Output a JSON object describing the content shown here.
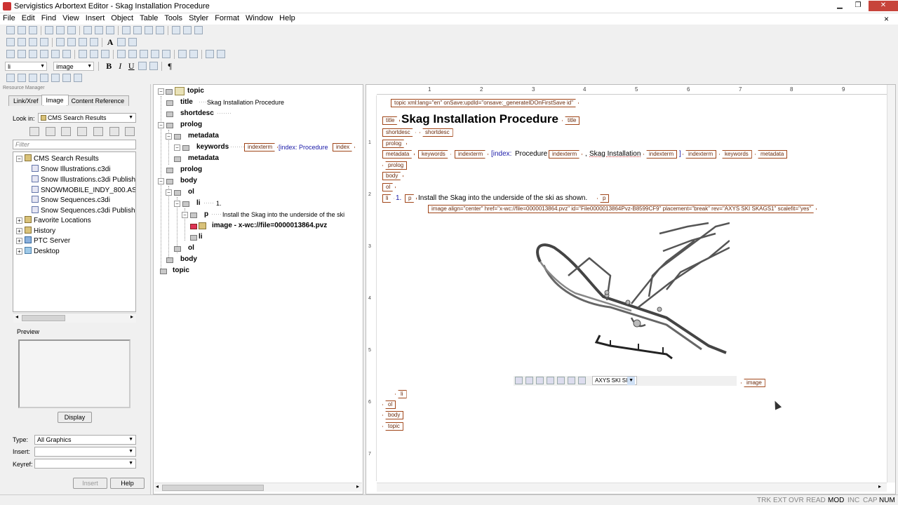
{
  "window": {
    "title": "Servigistics Arbortext Editor - Skag Installation Procedure",
    "min": "▁",
    "max": "❐",
    "close": "✕"
  },
  "menu": [
    "File",
    "Edit",
    "Find",
    "View",
    "Insert",
    "Object",
    "Table",
    "Tools",
    "Styler",
    "Format",
    "Window",
    "Help"
  ],
  "menu_close": "×",
  "toolbar": {
    "element_combo": "li",
    "style_combo": "image",
    "bold": "B",
    "italic": "I",
    "underline": "U",
    "pilcrow": "¶"
  },
  "resource_manager": {
    "panel_title": "Resource Manager",
    "tabs": [
      "Link/Xref",
      "Image",
      "Content Reference"
    ],
    "look_in_label": "Look in:",
    "look_in_value": "CMS Search Results",
    "filter_placeholder": "Filter",
    "tree": [
      {
        "label": "CMS Search Results",
        "level": 0,
        "expander": "−",
        "kind": "folder"
      },
      {
        "label": "Snow Illustrations.c3di",
        "level": 1,
        "expander": "",
        "kind": "doc"
      },
      {
        "label": "Snow Illustrations.c3di Publishe",
        "level": 1,
        "expander": "",
        "kind": "doc"
      },
      {
        "label": "SNOWMOBILE_INDY_800.ASM",
        "level": 1,
        "expander": "",
        "kind": "doc"
      },
      {
        "label": "Snow Sequences.c3di",
        "level": 1,
        "expander": "",
        "kind": "doc"
      },
      {
        "label": "Snow Sequences.c3di Publishe",
        "level": 1,
        "expander": "",
        "kind": "doc"
      },
      {
        "label": "Favorite Locations",
        "level": 0,
        "expander": "+",
        "kind": "folder"
      },
      {
        "label": "History",
        "level": 0,
        "expander": "+",
        "kind": "folder"
      },
      {
        "label": "PTC Server",
        "level": 0,
        "expander": "+",
        "kind": "folder"
      },
      {
        "label": "Desktop",
        "level": 0,
        "expander": "+",
        "kind": "folder"
      }
    ],
    "preview_label": "Preview",
    "display_button": "Display",
    "type_label": "Type:",
    "type_value": "All Graphics",
    "insert_label": "Insert:",
    "insert_value": "",
    "keyref_label": "Keyref:",
    "keyref_value": "",
    "insert_button": "Insert",
    "help_button": "Help"
  },
  "structure": {
    "rows": [
      {
        "label": "topic",
        "text": ""
      },
      {
        "label": "title",
        "text": "Skag Installation Procedure"
      },
      {
        "label": "shortdesc",
        "text": ""
      },
      {
        "label": "prolog",
        "text": ""
      },
      {
        "label": "metadata",
        "text": ""
      },
      {
        "label": "keywords",
        "text": ""
      },
      {
        "label": "metadata",
        "text": ""
      },
      {
        "label": "prolog",
        "text": ""
      },
      {
        "label": "body",
        "text": ""
      },
      {
        "label": "ol",
        "text": ""
      },
      {
        "label": "li",
        "text": "1."
      },
      {
        "label": "p",
        "text": "Install the Skag into the underside of the ski"
      },
      {
        "label": "image - x-wc://file=0000013864.pvz",
        "text": ""
      },
      {
        "label": "li",
        "text": ""
      },
      {
        "label": "ol",
        "text": ""
      },
      {
        "label": "body",
        "text": ""
      },
      {
        "label": "topic",
        "text": ""
      }
    ],
    "keywords_tag": "indexterm",
    "keywords_index": "[index: Procedure",
    "keywords_tag2": "index"
  },
  "ruler_numbers": [
    "1",
    "2",
    "3",
    "4",
    "5",
    "6",
    "7",
    "8",
    "9"
  ],
  "vruler_numbers": [
    "1",
    "2",
    "3",
    "4",
    "5",
    "6",
    "7"
  ],
  "document": {
    "topic_attrs": "topic xml:lang=\"en\" onSave:updId=\"onsave:_generateIDOnFirstSave id\"",
    "title_tag": "title",
    "title_text": "Skag Installation Procedure",
    "shortdesc_tag": "shortdesc",
    "prolog_tag": "prolog",
    "metadata_tag": "metadata",
    "keywords_tag": "keywords",
    "indexterm_tag": "indexterm",
    "index_label": "[index:",
    "index_term1": "Procedure",
    "comma": ",",
    "index_term2": "Skag Installation",
    "bracket": "]",
    "body_tag": "body",
    "ol_tag": "ol",
    "li_tag": "li",
    "p_tag": "p",
    "item_number": "1.",
    "step_text": "Install the Skag into the underside of the ski as shown.",
    "image_attrs": "image align=\"center\" href=\"x-wc://file=0000013864.pvz\" id=\"File0000013864Pvz-B8599CF9\" placement=\"break\" rev=\"AXYS SKI SKAGS1\" scalefit=\"yes\"",
    "image_tag": "image",
    "image_viewer_combo": "AXYS SKI SI",
    "topic_tag": "topic"
  },
  "status": [
    "TRK",
    "EXT",
    "OVR",
    "READ",
    "MOD",
    "INC",
    "CAP",
    "NUM"
  ],
  "status_active": [
    "MOD",
    "NUM"
  ],
  "colors": {
    "tag_border": "#a04518",
    "index_text": "#1a1aa8",
    "close_button": "#c7443b"
  }
}
